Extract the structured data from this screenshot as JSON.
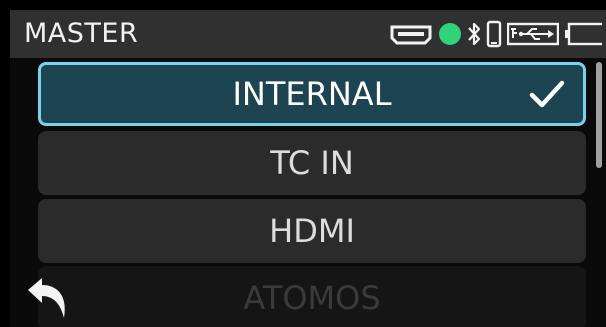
{
  "header": {
    "title": "MASTER",
    "icons": [
      "hdmi-icon",
      "status-dot-icon",
      "bluetooth-icon",
      "phone-icon",
      "usb-power-icon",
      "battery-icon"
    ],
    "status_dot_color": "#2fd37a"
  },
  "menu": {
    "items": [
      {
        "label": "INTERNAL",
        "selected": true
      },
      {
        "label": "TC IN",
        "selected": false
      },
      {
        "label": "HDMI",
        "selected": false
      },
      {
        "label": "ATOMOS",
        "selected": false
      }
    ]
  },
  "colors": {
    "accent": "#79d2ea",
    "selected_bg": "#1d4451",
    "item_bg": "#2b2b2b",
    "header_bg": "#303030"
  },
  "footer": {
    "icons": [
      "back-icon"
    ]
  }
}
